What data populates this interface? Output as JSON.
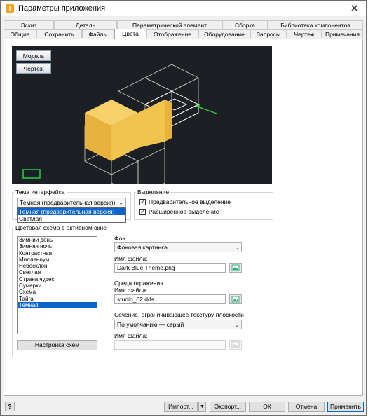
{
  "window": {
    "title": "Параметры приложения",
    "app_icon": "I"
  },
  "tabs_row1": [
    "Эскиз",
    "Деталь",
    "Параметрический элемент",
    "Сборка",
    "Библиотека компонентов"
  ],
  "tabs_row2": [
    "Общие",
    "Сохранить",
    "Файлы",
    "Цвета",
    "Отображение",
    "Оборудование",
    "Запросы",
    "Чертеж",
    "Примечания"
  ],
  "active_tab": "Цвета",
  "preview": {
    "model_button": "Модель",
    "drawing_button": "Чертеж"
  },
  "theme": {
    "legend": "Тема интерфейса",
    "selected": "Темная (предварительная версия)",
    "options": [
      "Темная (предварительная версия)",
      "Светлая"
    ]
  },
  "selection": {
    "legend": "Выделение",
    "preselect_label": "Предварительное выделение",
    "preselect_checked": true,
    "extended_label": "Расширенное выделение",
    "extended_checked": true
  },
  "scheme": {
    "legend": "Цветовая схема в активном окне",
    "items": [
      "Зимний день",
      "Зимняя ночь",
      "Контрастная",
      "Миллениум",
      "Небосклон",
      "Светлая",
      "Страна чудес",
      "Сумерки",
      "Схема",
      "Тайга",
      "Темная"
    ],
    "selected": "Темная",
    "settings_button": "Настройка схем"
  },
  "background": {
    "label": "Фон",
    "value": "Фоновая картинка",
    "file_label": "Имя файла:",
    "file": "Dark Blue Theme.png"
  },
  "reflection": {
    "label": "Среда отражения",
    "file_label": "Имя файла:",
    "file": "studio_02.dds"
  },
  "section": {
    "label": "Сечение, ограничивающее текстуру плоскости",
    "value": "По умолчанию — серый",
    "file_label": "Имя файла:",
    "file": ""
  },
  "footer": {
    "import": "Импорт...",
    "export": "Экспорт...",
    "ok": "ОК",
    "cancel": "Отмена",
    "apply": "Применить"
  },
  "colors": {
    "accent": "#0b64c8",
    "cube": "#f1c34f",
    "viewport": "#1c1f24"
  }
}
